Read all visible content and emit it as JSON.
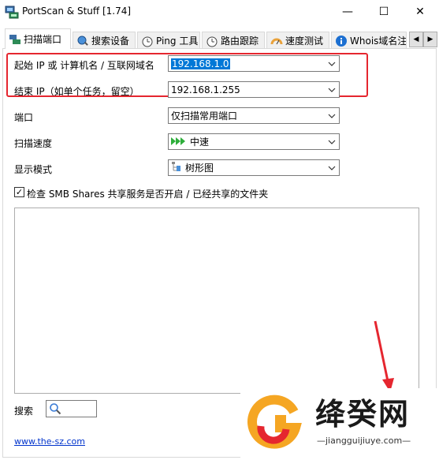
{
  "window": {
    "title": "PortScan & Stuff [1.74]",
    "minimize": "—",
    "maximize": "☐",
    "close": "✕"
  },
  "tabs": [
    {
      "label": "扫描端口",
      "icon": "scan-icon",
      "active": true
    },
    {
      "label": "搜索设备",
      "icon": "search-device-icon",
      "active": false
    },
    {
      "label": "Ping 工具",
      "icon": "stopwatch-icon",
      "active": false
    },
    {
      "label": "路由跟踪",
      "icon": "stopwatch-icon",
      "active": false
    },
    {
      "label": "速度测试",
      "icon": "gauge-icon",
      "active": false
    },
    {
      "label": "Whois域名注",
      "icon": "info-icon",
      "active": false
    }
  ],
  "form": {
    "start_ip_label": "起始 IP 或 计算机名 / 互联网域名",
    "start_ip_value": "192.168.1.0",
    "end_ip_label": "结束 IP（如单个任务，留空）",
    "end_ip_value": "192.168.1.255",
    "port_label": "端口",
    "port_value": "仅扫描常用端口",
    "speed_label": "扫描速度",
    "speed_value": "中速",
    "display_label": "显示模式",
    "display_value": "树形图",
    "smb_checkbox_label": "检查 SMB Shares 共享服务是否开启 / 已经共享的文件夹",
    "smb_checked": true,
    "search_label": "搜索"
  },
  "footer": {
    "link": "www.the-sz.com"
  },
  "watermark": {
    "text": "绛癸网",
    "sub": "—jiangguijiuye.com—"
  },
  "colors": {
    "highlight": "#e5262f",
    "selection": "#0078d7",
    "speed_arrows": "#2eae3b"
  }
}
